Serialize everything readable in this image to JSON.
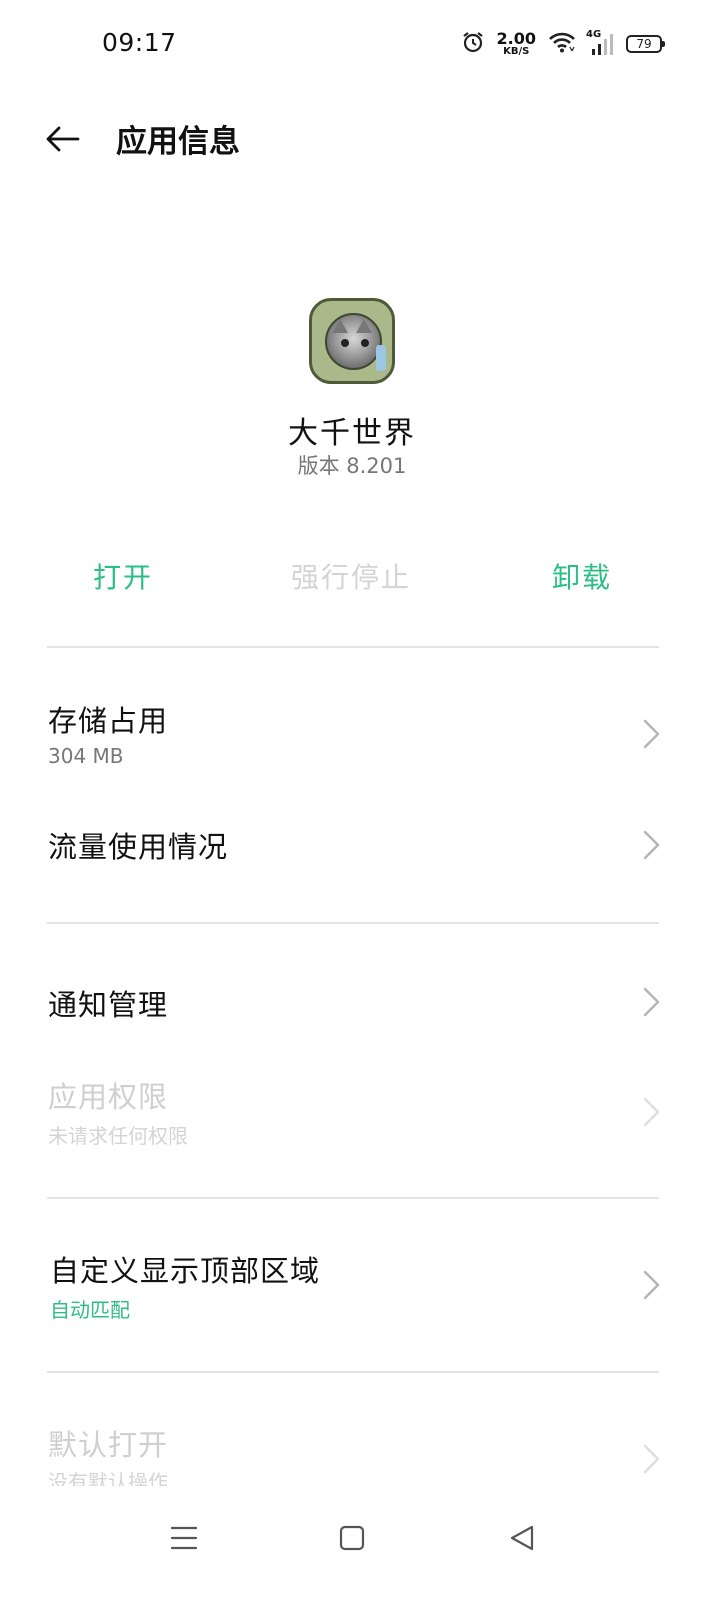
{
  "status_bar": {
    "time": "09:17",
    "net_speed_value": "2.00",
    "net_speed_unit": "KB/S",
    "network_type": "4G",
    "battery": "79"
  },
  "header": {
    "title": "应用信息"
  },
  "app": {
    "name": "大千世界",
    "version": "版本 8.201",
    "icon": "cat-photo-app-icon"
  },
  "actions": {
    "open": "打开",
    "force_stop": "强行停止",
    "uninstall": "卸载"
  },
  "sections": {
    "storage": {
      "title": "存储占用",
      "value": "304 MB"
    },
    "data_usage": {
      "title": "流量使用情况"
    },
    "notifications": {
      "title": "通知管理"
    },
    "permissions": {
      "title": "应用权限",
      "subtitle": "未请求任何权限"
    },
    "display_area": {
      "title": "自定义显示顶部区域",
      "subtitle": "自动匹配"
    },
    "default_open": {
      "title": "默认打开",
      "subtitle": "没有默认操作"
    }
  },
  "colors": {
    "accent": "#2cbf84",
    "disabled": "#d4d4d4",
    "divider": "#e4e4e4"
  }
}
